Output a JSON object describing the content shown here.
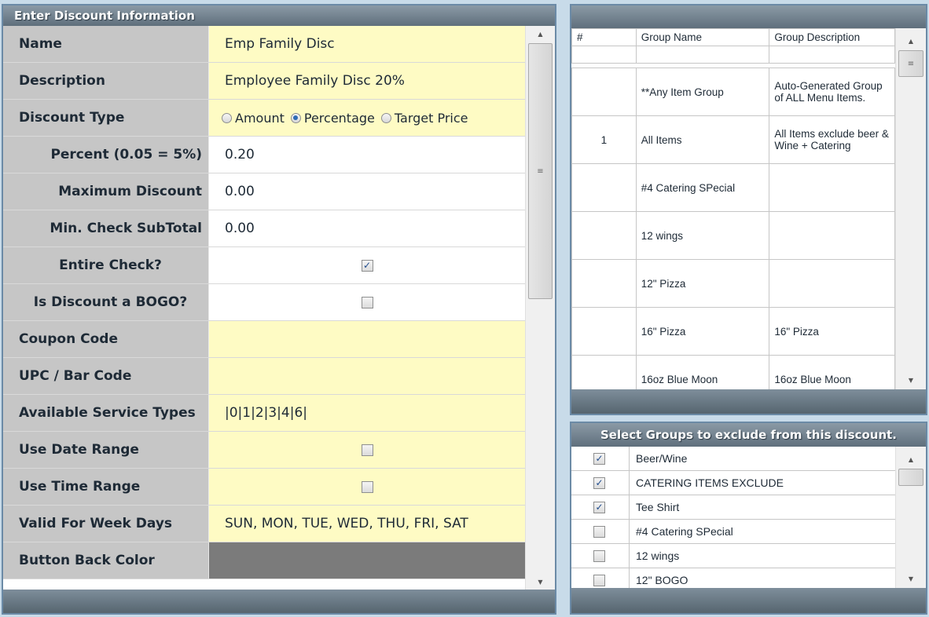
{
  "discount_panel": {
    "title": "Enter Discount Information",
    "fields": {
      "name": {
        "label": "Name",
        "value": "Emp Family Disc"
      },
      "description": {
        "label": "Description",
        "value": "Employee Family Disc 20%"
      },
      "discount_type": {
        "label": "Discount Type",
        "options": [
          "Amount",
          "Percentage",
          "Target Price"
        ],
        "selected": "Percentage"
      },
      "percent": {
        "label": "Percent (0.05 = 5%)",
        "value": "0.20"
      },
      "maximum_discount": {
        "label": "Maximum Discount",
        "value": "0.00"
      },
      "min_check_subtotal": {
        "label": "Min. Check SubTotal",
        "value": "0.00"
      },
      "entire_check": {
        "label": "Entire Check?",
        "checked": true
      },
      "is_bogo": {
        "label": "Is Discount a BOGO?",
        "checked": false
      },
      "coupon_code": {
        "label": "Coupon Code",
        "value": ""
      },
      "upc_bar_code": {
        "label": "UPC / Bar Code",
        "value": ""
      },
      "available_service_types": {
        "label": "Available Service Types",
        "value": "|0|1|2|3|4|6|"
      },
      "use_date_range": {
        "label": "Use Date Range",
        "checked": false
      },
      "use_time_range": {
        "label": "Use Time Range",
        "checked": false
      },
      "valid_week_days": {
        "label": "Valid For Week Days",
        "value": "SUN, MON, TUE, WED, THU, FRI, SAT"
      },
      "button_back_color": {
        "label": "Button Back Color",
        "value": "#7b7b7b"
      }
    }
  },
  "groups_grid": {
    "columns": [
      "#",
      "Group Name",
      "Group Description"
    ],
    "rows": [
      {
        "num": "",
        "name": "**Any Item Group",
        "description": "Auto-Generated Group of ALL Menu Items."
      },
      {
        "num": "1",
        "name": "All Items",
        "description": "All Items exclude beer & Wine + Catering"
      },
      {
        "num": "",
        "name": "#4 Catering SPecial",
        "description": ""
      },
      {
        "num": "",
        "name": "12 wings",
        "description": ""
      },
      {
        "num": "",
        "name": "12\" Pizza",
        "description": ""
      },
      {
        "num": "",
        "name": "16\" Pizza",
        "description": "16\" Pizza"
      },
      {
        "num": "",
        "name": "16oz Blue Moon",
        "description": "16oz Blue Moon"
      }
    ]
  },
  "exclude_panel": {
    "title": "Select Groups to exclude from this discount.",
    "items": [
      {
        "label": "Beer/Wine",
        "checked": true
      },
      {
        "label": "CATERING ITEMS EXCLUDE",
        "checked": true
      },
      {
        "label": "Tee Shirt",
        "checked": true
      },
      {
        "label": "#4 Catering SPecial",
        "checked": false
      },
      {
        "label": "12 wings",
        "checked": false
      },
      {
        "label": "12\" BOGO",
        "checked": false
      }
    ]
  },
  "icons": {
    "check_mark": "✓",
    "scroll_up": "▲",
    "scroll_down": "▼",
    "grip": "≡"
  },
  "colors": {
    "panel_header": "#6f7f8c",
    "label_bg": "#c6c6c6",
    "input_bg": "#fefbc4",
    "background": "#c8dbe9"
  }
}
